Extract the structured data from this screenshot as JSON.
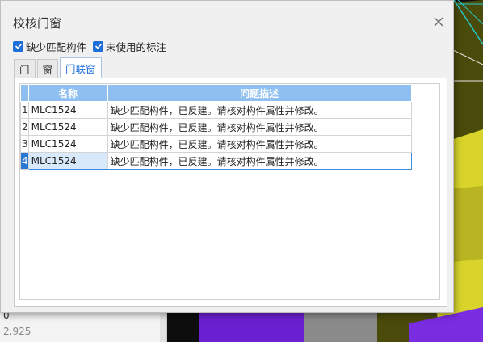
{
  "background": {
    "values": [
      "0",
      "2.925"
    ]
  },
  "dialog": {
    "title": "校核门窗",
    "close_icon": "close-icon",
    "checkboxes": [
      {
        "label": "缺少匹配构件",
        "checked": true
      },
      {
        "label": "未使用的标注",
        "checked": true
      }
    ],
    "tabs": [
      {
        "label": "门",
        "active": false
      },
      {
        "label": "窗",
        "active": false
      },
      {
        "label": "门联窗",
        "active": true
      }
    ],
    "table": {
      "headers": [
        "名称",
        "问题描述"
      ],
      "rows": [
        {
          "index": "1",
          "name": "MLC1524",
          "desc": "缺少匹配构件，已反建。请核对构件属性并修改。"
        },
        {
          "index": "2",
          "name": "MLC1524",
          "desc": "缺少匹配构件，已反建。请核对构件属性并修改。"
        },
        {
          "index": "3",
          "name": "MLC1524",
          "desc": "缺少匹配构件，已反建。请核对构件属性并修改。"
        },
        {
          "index": "4",
          "name": "MLC1524",
          "desc": "缺少匹配构件，已反建。请核对构件属性并修改。",
          "selected": true
        }
      ]
    }
  },
  "colors": {
    "accent": "#1e6fd9",
    "header_bg": "#8ebff0",
    "cad_yellow": "#d8d42a",
    "cad_purple": "#6a1fd0",
    "cad_olive": "#4a4a0a"
  }
}
